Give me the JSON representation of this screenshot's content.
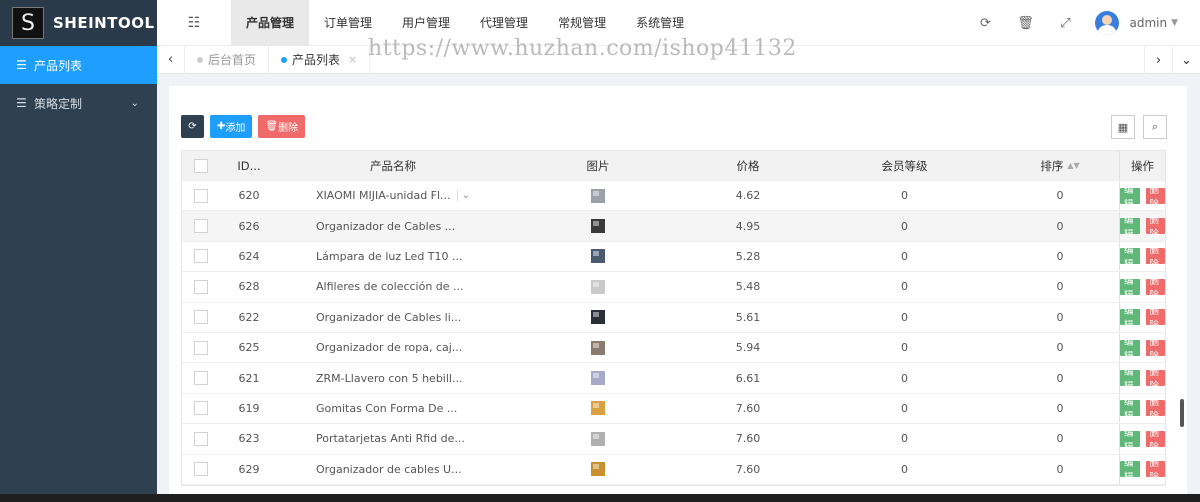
{
  "app": {
    "logo_letter": "S",
    "name": "SHEINTOOL"
  },
  "sidebar": {
    "items": [
      {
        "label": "产品列表",
        "active": true
      },
      {
        "label": "策略定制",
        "active": false
      }
    ]
  },
  "header": {
    "nav": [
      "产品管理",
      "订单管理",
      "用户管理",
      "代理管理",
      "常规管理",
      "系统管理"
    ],
    "active_nav": "产品管理",
    "user_name": "admin"
  },
  "tabs": [
    {
      "label": "后台首页",
      "active": false
    },
    {
      "label": "产品列表",
      "active": true
    }
  ],
  "watermark": "https://www.huzhan.com/ishop41132",
  "toolbar": {
    "add_label": "添加",
    "delete_label": "删除"
  },
  "table": {
    "columns": {
      "id": "ID...",
      "name": "产品名称",
      "image": "图片",
      "price": "价格",
      "level": "会员等级",
      "sort": "排序",
      "ops": "操作"
    },
    "edit_label": "编辑",
    "delete_label": "删除",
    "rows": [
      {
        "id": "620",
        "name": "XIAOMI MIJIA-unidad Fl...",
        "price": "4.62",
        "level": "0",
        "sort": "0",
        "thumb_color": "#9aa0a8"
      },
      {
        "id": "626",
        "name": "Organizador de Cables ...",
        "price": "4.95",
        "level": "0",
        "sort": "0",
        "thumb_color": "#3a3a3a"
      },
      {
        "id": "624",
        "name": "Lámpara de luz Led T10 ...",
        "price": "5.28",
        "level": "0",
        "sort": "0",
        "thumb_color": "#4a5a70"
      },
      {
        "id": "628",
        "name": "Alfileres de colección de ...",
        "price": "5.48",
        "level": "0",
        "sort": "0",
        "thumb_color": "#c9c9c9"
      },
      {
        "id": "622",
        "name": "Organizador de Cables li...",
        "price": "5.61",
        "level": "0",
        "sort": "0",
        "thumb_color": "#2a2f3a"
      },
      {
        "id": "625",
        "name": "Organizador de ropa, caj...",
        "price": "5.94",
        "level": "0",
        "sort": "0",
        "thumb_color": "#8a7a70"
      },
      {
        "id": "621",
        "name": "ZRM-Llavero con 5 hebill...",
        "price": "6.61",
        "level": "0",
        "sort": "0",
        "thumb_color": "#a8a8c8"
      },
      {
        "id": "619",
        "name": "Gomitas Con Forma De ...",
        "price": "7.60",
        "level": "0",
        "sort": "0",
        "thumb_color": "#d8a040"
      },
      {
        "id": "623",
        "name": "Portatarjetas Anti Rfid de...",
        "price": "7.60",
        "level": "0",
        "sort": "0",
        "thumb_color": "#b0b0b0"
      },
      {
        "id": "629",
        "name": "Organizador de cables U...",
        "price": "7.60",
        "level": "0",
        "sort": "0",
        "thumb_color": "#c89030"
      }
    ]
  },
  "colors": {
    "accent": "#1e9fff",
    "sidebar": "#2f4050",
    "edit": "#5fb878",
    "danger": "#f06a6a"
  }
}
